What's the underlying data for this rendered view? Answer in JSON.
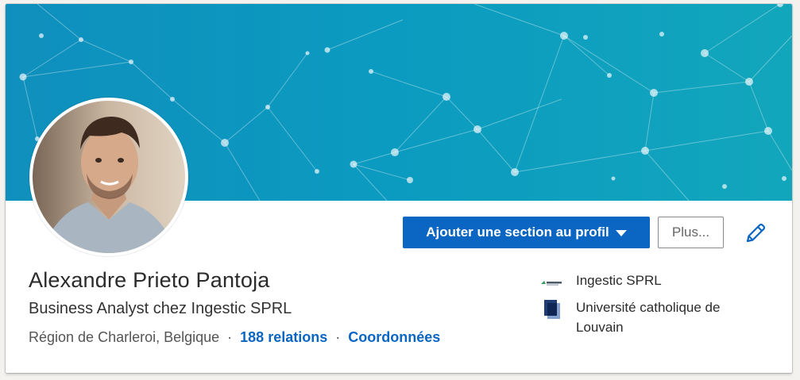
{
  "profile": {
    "name": "Alexandre Prieto Pantoja",
    "headline": "Business Analyst chez Ingestic SPRL",
    "location": "Région de Charleroi, Belgique",
    "separator": "·",
    "connections_label": "188 relations",
    "contact_label": "Coordonnées"
  },
  "actions": {
    "add_section_label": "Ajouter une section au profil",
    "more_label": "Plus..."
  },
  "experience": [
    {
      "name": "Ingestic SPRL",
      "logo_text": "INGESTIC",
      "icon": "company-logo"
    },
    {
      "name": "Université catholique de Louvain",
      "icon": "school-logo"
    }
  ],
  "colors": {
    "accent": "#0a66c2",
    "banner": "#0b9bc0"
  }
}
